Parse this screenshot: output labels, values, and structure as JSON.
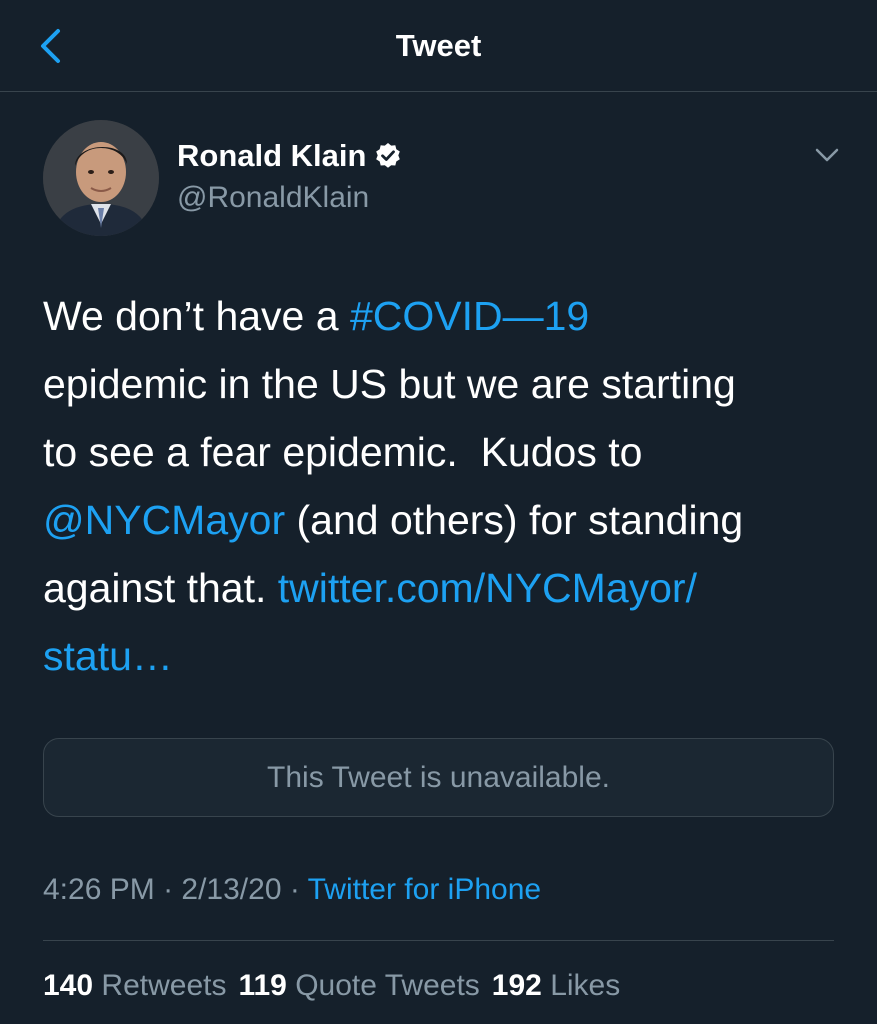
{
  "header": {
    "title": "Tweet",
    "back_icon": "chevron-left-icon"
  },
  "author": {
    "name": "Ronald Klain",
    "handle": "@RonaldKlain",
    "verified": true
  },
  "tweet": {
    "t1": "We don’t have a ",
    "hashtag": "#COVID—19",
    "t2": "\nepidemic in the US but we are starting\nto see a fear epidemic.  Kudos to\n",
    "mention": "@NYCMayor",
    "t3": " (and others) for standing\nagainst that. ",
    "link": "twitter.com/NYCMayor/\nstatu…"
  },
  "quote": {
    "text": "This Tweet is unavailable."
  },
  "meta": {
    "time": "4:26 PM",
    "sep1": " · ",
    "date": "2/13/20",
    "sep2": " · ",
    "source": "Twitter for iPhone"
  },
  "stats": {
    "retweets_count": "140",
    "retweets_label": "Retweets",
    "quotes_count": "119",
    "quotes_label": "Quote Tweets",
    "likes_count": "192",
    "likes_label": "Likes"
  },
  "colors": {
    "background": "#15202b",
    "accent": "#1da1f2",
    "secondary_text": "#8899a6",
    "border": "#38444d"
  }
}
